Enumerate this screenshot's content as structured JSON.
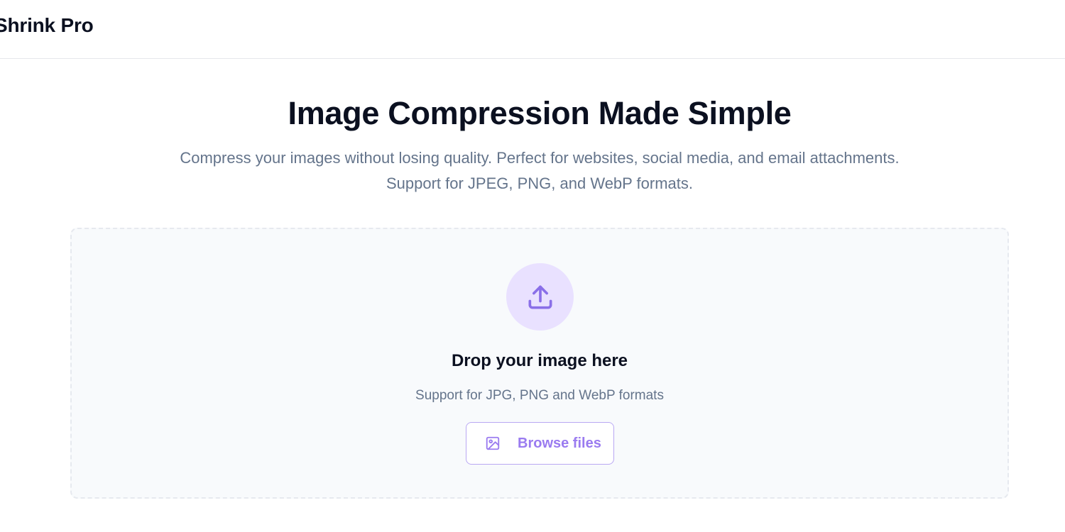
{
  "app": {
    "brand": "Shrink Pro"
  },
  "hero": {
    "title": "Image Compression Made Simple",
    "subtitle": "Compress your images without losing quality. Perfect for websites, social media, and email attachments. Support for JPEG, PNG, and WebP formats."
  },
  "dropzone": {
    "icon": "upload-icon",
    "title": "Drop your image here",
    "subtitle": "Support for JPG, PNG and WebP formats",
    "browse_icon": "image-icon",
    "browse_label": "Browse files"
  },
  "colors": {
    "accent": "#9a7bf0",
    "accent_light": "#e9e1ff",
    "text_primary": "#0b1020",
    "text_muted": "#64748b",
    "dropzone_bg": "#f8fafc",
    "border": "#e5e7eb"
  }
}
